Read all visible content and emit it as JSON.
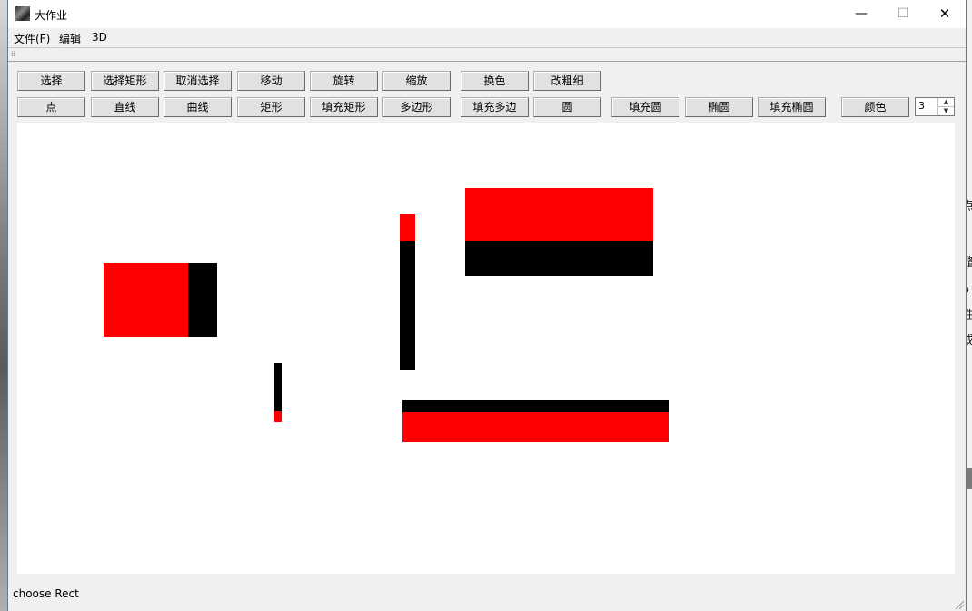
{
  "window": {
    "title": "大作业",
    "controls": {
      "minimize": "—",
      "maximize": "☐",
      "close": "✕"
    }
  },
  "menu": {
    "items": [
      "文件(F)",
      "编辑",
      "3D"
    ]
  },
  "toolbar": {
    "row1": [
      "选择",
      "选择矩形",
      "取消选择",
      "移动",
      "旋转",
      "缩放",
      "换色",
      "改粗细"
    ],
    "row2": [
      "点",
      "直线",
      "曲线",
      "矩形",
      "填充矩形",
      "多边形",
      "填充多边",
      "圆",
      "填充圆",
      "椭圆",
      "填充椭圆",
      "颜色"
    ],
    "line_width": "3"
  },
  "canvas": {
    "shapes": [
      {
        "name": "filled-rect-1",
        "colors": [
          "#ff0000",
          "#000000"
        ]
      },
      {
        "name": "filled-rect-2",
        "colors": [
          "#000000",
          "#ff0000"
        ]
      },
      {
        "name": "filled-rect-3",
        "colors": [
          "#ff0000",
          "#000000"
        ]
      },
      {
        "name": "filled-rect-4",
        "colors": [
          "#ff0000",
          "#000000"
        ]
      },
      {
        "name": "filled-rect-5",
        "colors": [
          "#000000",
          "#ff0000"
        ]
      }
    ]
  },
  "status": {
    "text": "choose Rect"
  },
  "colors": {
    "accent_red": "#ff0000",
    "shape_black": "#000000",
    "canvas_bg": "#ffffff",
    "chrome_bg": "#f0f0f0"
  },
  "desktop_partial_chars": [
    "点",
    "鼇",
    "o",
    "性",
    "或"
  ]
}
